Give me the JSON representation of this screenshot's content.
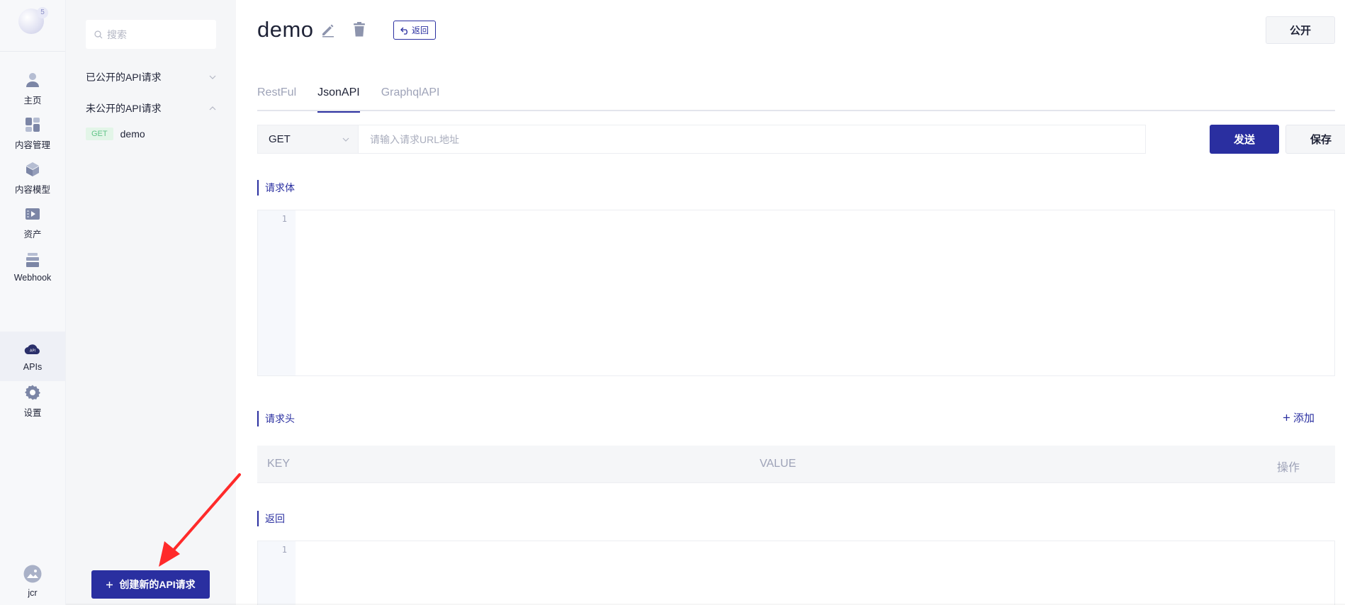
{
  "rail": {
    "logo_badge": "5",
    "items": [
      {
        "label": "主页",
        "icon": "user-icon"
      },
      {
        "label": "内容管理",
        "icon": "dashboard-icon"
      },
      {
        "label": "内容模型",
        "icon": "cube-icon"
      },
      {
        "label": "资产",
        "icon": "media-icon"
      },
      {
        "label": "Webhook",
        "icon": "webhook-icon"
      },
      {
        "label": "APIs",
        "icon": "api-cloud-icon",
        "active": true
      },
      {
        "label": "设置",
        "icon": "gear-icon"
      }
    ],
    "user": {
      "name": "jcr",
      "icon": "avatar-icon"
    }
  },
  "sidebar": {
    "search_placeholder": "搜索",
    "groups": [
      {
        "label": "已公开的API请求",
        "expanded": false
      },
      {
        "label": "未公开的API请求",
        "expanded": true
      }
    ],
    "apis": [
      {
        "method": "GET",
        "name": "demo"
      }
    ],
    "create_button": "创建新的API请求"
  },
  "main": {
    "title": "demo",
    "back_label": "返回",
    "publish_label": "公开",
    "tabs": [
      {
        "label": "RestFul",
        "active": false
      },
      {
        "label": "JsonAPI",
        "active": true
      },
      {
        "label": "GraphqlAPI",
        "active": false
      }
    ],
    "method": "GET",
    "url_placeholder": "请输入请求URL地址",
    "url_value": "",
    "send_label": "发送",
    "save_label": "保存",
    "body_label": "请求体",
    "body_line": "1",
    "headers_label": "请求头",
    "add_label": "添加",
    "headers_table": {
      "columns": [
        "KEY",
        "VALUE",
        "操作"
      ],
      "rows": []
    },
    "response_label": "返回",
    "response_line": "1"
  },
  "colors": {
    "primary": "#2a2fa0",
    "get_tag_bg": "#e3f5e8",
    "get_tag_text": "#61c487",
    "annotation": "#ff2a2a"
  }
}
